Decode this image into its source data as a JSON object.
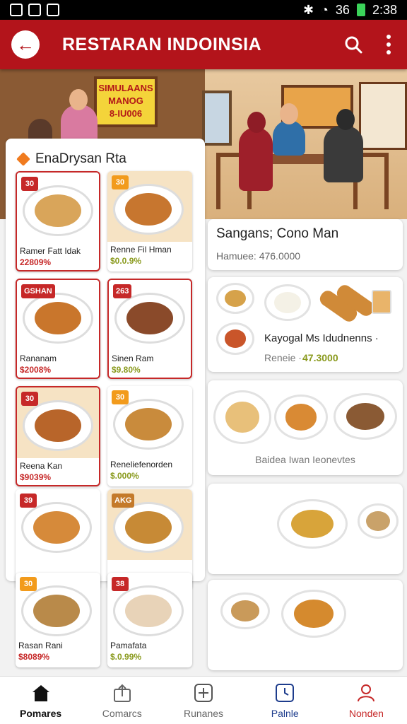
{
  "status_bar": {
    "time": "2:38",
    "signal": "36"
  },
  "app_bar": {
    "title": "RESTARAN INDOINSIA",
    "back_icon": "arrow-left-icon",
    "search_icon": "search-icon",
    "more_icon": "more-vertical-icon"
  },
  "scene": {
    "sign_lines": [
      "SIMULAANS",
      "MANOG",
      "8-IU006"
    ]
  },
  "left_panel": {
    "title": "EnaDrysan Rta",
    "items": [
      {
        "badge": "30",
        "badge_color": "#c62828",
        "name": "Ramer Fatt Idak",
        "price": "22809%",
        "price_color": "#c62828",
        "dish_color": "#d9a55a",
        "border": true
      },
      {
        "badge": "30",
        "badge_color": "#f29b1c",
        "name": "Renne Fil Hman",
        "price": "$0.0.9%",
        "price_color": "#8a9a1e",
        "dish_color": "#c7762f",
        "border": false
      },
      {
        "badge": "GSHAN",
        "badge_color": "#c62828",
        "name": "Rananam",
        "price": "$2008%",
        "price_color": "#c62828",
        "dish_color": "#c9762c",
        "border": true
      },
      {
        "badge": "263",
        "badge_color": "#c62828",
        "name": "Sinen Ram",
        "price": "$9.80%",
        "price_color": "#8a9a1e",
        "dish_color": "#8a4a2a",
        "border": true
      },
      {
        "badge": "30",
        "badge_color": "#c62828",
        "name": "Reena Kan",
        "price": "$9039%",
        "price_color": "#c62828",
        "dish_color": "#b8652a",
        "border": true
      },
      {
        "badge": "30",
        "badge_color": "#f29b1c",
        "name": "Reneliefenorden",
        "price": "$.000%",
        "price_color": "#8a9a1e",
        "dish_color": "#c98b3c",
        "border": false
      },
      {
        "badge": "39",
        "badge_color": "#c62828",
        "name": "",
        "price": "",
        "price_color": "#c62828",
        "dish_color": "#d68a3a",
        "border": false
      },
      {
        "badge": "AKG",
        "badge_color": "#c47a2a",
        "name": "",
        "price": "",
        "price_color": "#8a9a1e",
        "dish_color": "#c78a36",
        "border": false
      },
      {
        "badge": "30",
        "badge_color": "#f29b1c",
        "name": "Rasan Rani",
        "price": "$8089%",
        "price_color": "#c62828",
        "dish_color": "#b98a4a",
        "border": false
      },
      {
        "badge": "38",
        "badge_color": "#c62828",
        "name": "Pamafata",
        "price": "$.0.99%",
        "price_color": "#8a9a1e",
        "dish_color": "#e8d3b8",
        "border": false
      }
    ]
  },
  "right_cards": {
    "card1": {
      "title": "Sangans; Cono Man",
      "sub": "Hamuee:  476.0000"
    },
    "card2": {
      "text": "Kayogal Ms Idudnenns ·",
      "sub_label": "Reneie ·",
      "price": "47.3000",
      "price_color": "#8a9a1e"
    },
    "card3": {
      "caption": "Baidea Iwan Ieonevtes"
    }
  },
  "bottom_nav": [
    {
      "label": "Pomares",
      "icon": "home-icon",
      "color": "#111"
    },
    {
      "label": "Comarcs",
      "icon": "bag-upload-icon",
      "color": "#666"
    },
    {
      "label": "Runanes",
      "icon": "plus-box-icon",
      "color": "#666"
    },
    {
      "label": "Palnle",
      "icon": "clock-square-icon",
      "color": "#1d3c8c"
    },
    {
      "label": "Nonden",
      "icon": "person-icon",
      "color": "#c62828"
    }
  ]
}
